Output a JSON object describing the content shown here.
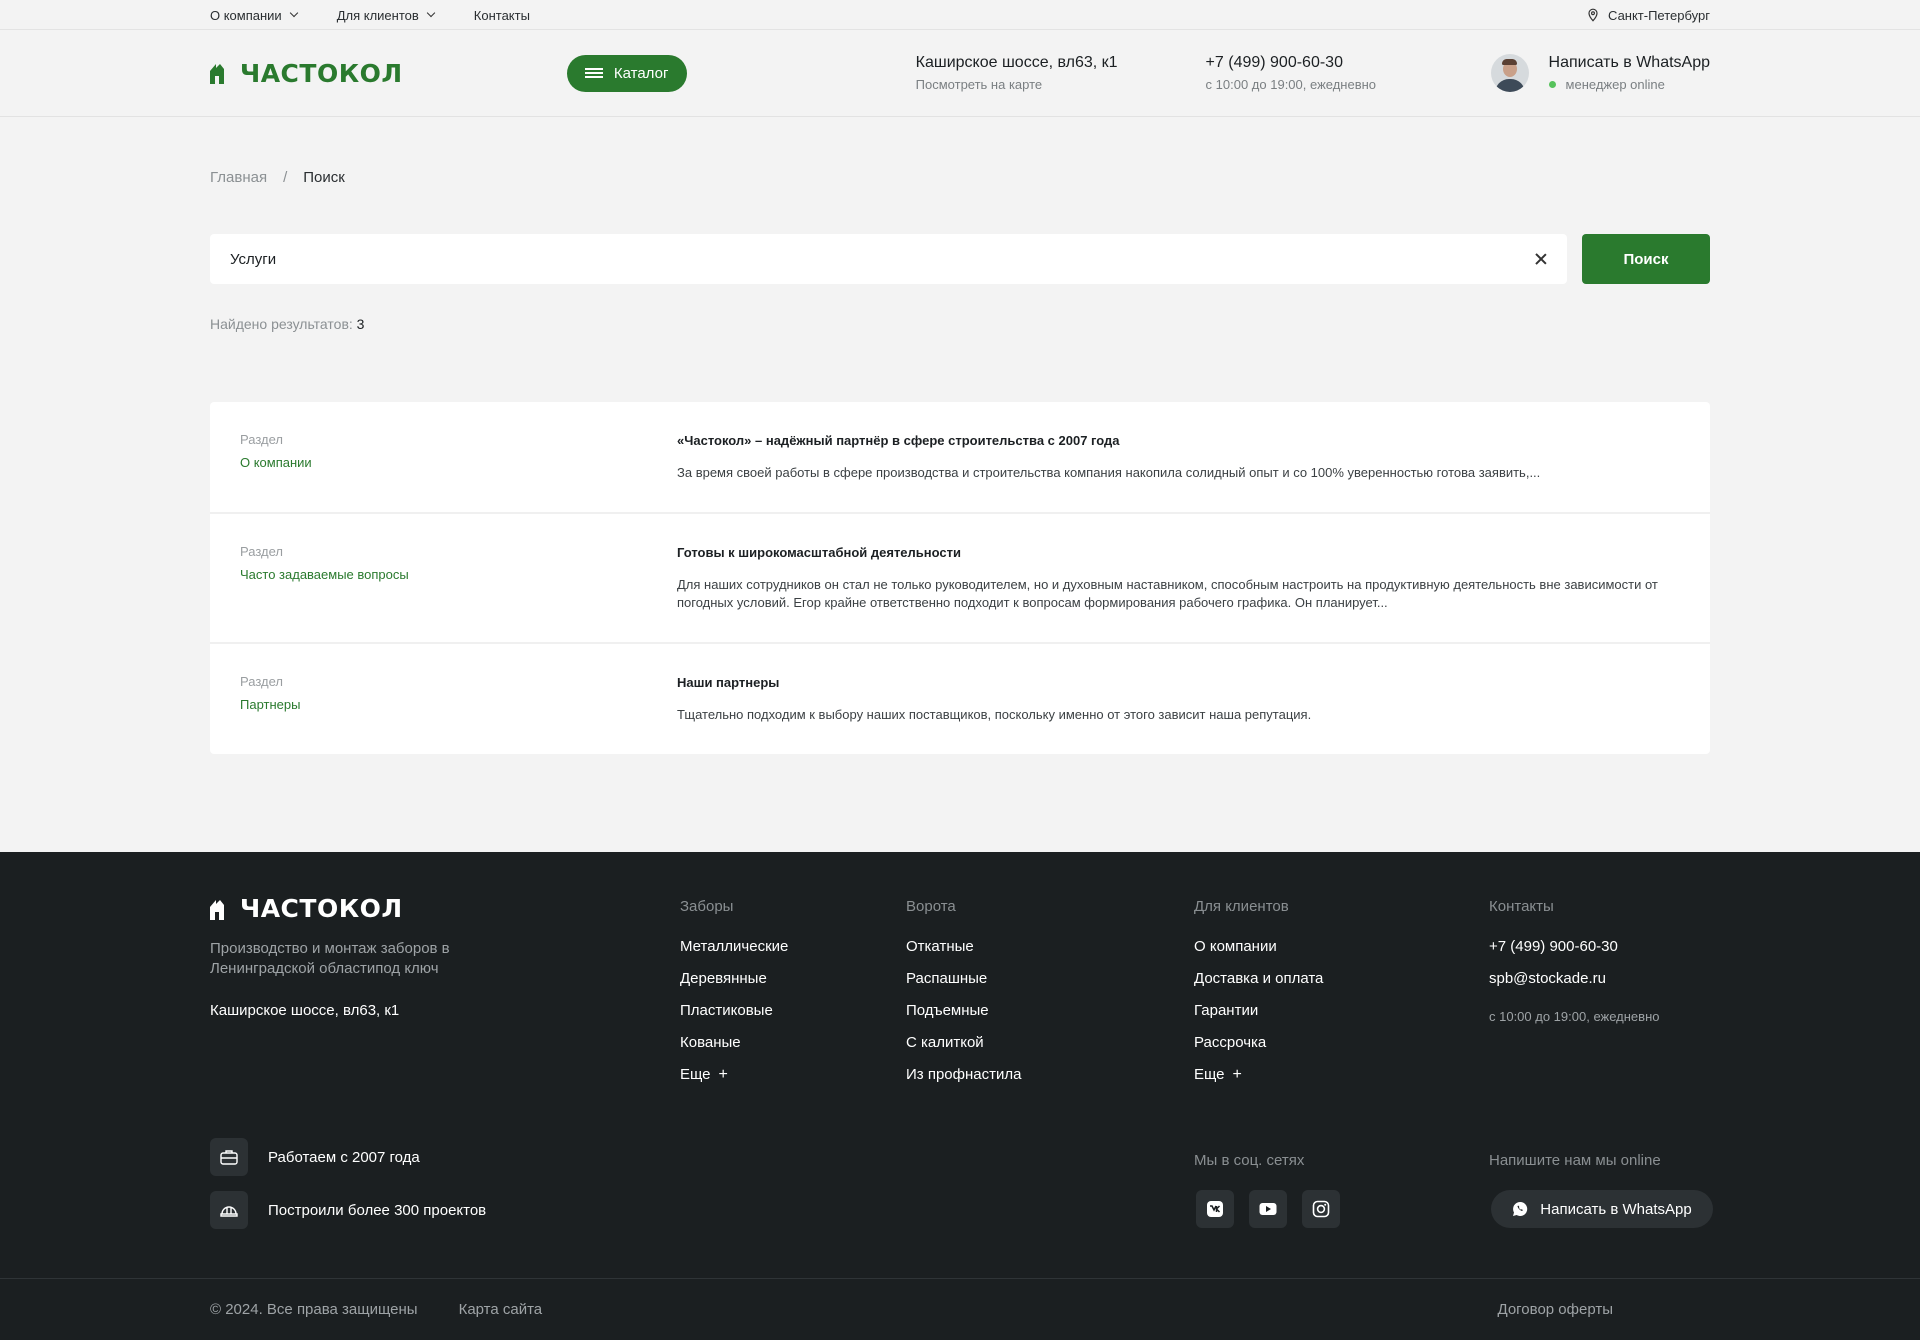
{
  "topbar": {
    "links": [
      "О компании",
      "Для клиентов",
      "Контакты"
    ],
    "city": "Санкт-Петербург"
  },
  "header": {
    "logo": "ЧАСТОКОЛ",
    "catalog": "Каталог",
    "address": "Каширское шоссе, вл63, к1",
    "address_sub": "Посмотреть на карте",
    "phone": "+7 (499) 900-60-30",
    "hours": "с 10:00 до 19:00, ежедневно",
    "whatsapp": "Написать в WhatsApp",
    "manager": "менеджер online"
  },
  "breadcrumb": {
    "home": "Главная",
    "sep": "/",
    "current": "Поиск"
  },
  "search": {
    "value": "Услуги",
    "button": "Поиск"
  },
  "found": {
    "label": "Найдено результатов:",
    "count": "3"
  },
  "results": [
    {
      "kind": "Раздел",
      "section": "О компании",
      "title": "«Частокол» – надёжный партнёр в сфере строительства с 2007 года",
      "text": "За время своей работы в сфере производства и строительства компания накопила солидный опыт и со 100% уверенностью готова заявить,..."
    },
    {
      "kind": "Раздел",
      "section": "Часто задаваемые вопросы",
      "title": "Готовы к широкомасштабной деятельности",
      "text": "Для наших сотрудников он стал не только руководителем, но и духовным наставником, способным настроить на продуктивную деятельность вне зависимости от погодных условий. Егор крайне ответственно подходит к вопросам формирования рабочего графика. Он планирует..."
    },
    {
      "kind": "Раздел",
      "section": "Партнеры",
      "title": "Наши партнеры",
      "text": "Тщательно подходим к выбору наших поставщиков, поскольку именно от этого зависит наша репутация."
    }
  ],
  "footer": {
    "logo": "ЧАСТОКОЛ",
    "desc": "Производство и монтаж заборов в Ленинградской областипод ключ",
    "address": "Каширское шоссе, вл63, к1",
    "fences": {
      "head": "Заборы",
      "items": [
        "Металлические",
        "Деревянные",
        "Пластиковые",
        "Кованые"
      ],
      "more": "Еще"
    },
    "gates": {
      "head": "Ворота",
      "items": [
        "Откатные",
        "Распашные",
        "Подъемные",
        "С калиткой",
        "Из профнастила"
      ]
    },
    "clients": {
      "head": "Для клиентов",
      "items": [
        "О компании",
        "Доставка и оплата",
        "Гарантии",
        "Рассрочка"
      ],
      "more": "Еще"
    },
    "contacts": {
      "head": "Контакты",
      "phone": "+7 (499) 900-60-30",
      "email": "spb@stockade.ru",
      "hours": "с 10:00 до 19:00, ежедневно"
    },
    "feature1": "Работаем с 2007 года",
    "feature2": "Построили более 300 проектов",
    "social_head": "Мы в соц. сетях",
    "write_head": "Напишите нам мы online",
    "whatsapp": "Написать в WhatsApp",
    "copyright": "© 2024. Все права защищены",
    "sitemap": "Карта сайта",
    "offer": "Договор оферты"
  },
  "colors": {
    "brand": "#2a7a2e",
    "footer_bg": "#1b1f21",
    "online": "#56c25b"
  }
}
